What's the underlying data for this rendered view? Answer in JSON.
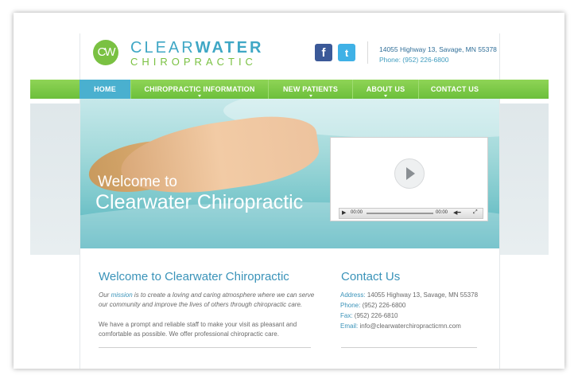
{
  "logo": {
    "mark": "CW",
    "line1_light": "CLEAR",
    "line1_bold": "WATER",
    "line2": "CHIROPRACTIC"
  },
  "social": {
    "facebook": "f",
    "twitter": "t"
  },
  "header_contact": {
    "address": "14055 Highway 13, Savage, MN 55378",
    "phone": "Phone: (952) 226-6800"
  },
  "nav": {
    "items": [
      {
        "label": "HOME",
        "active": true
      },
      {
        "label": "CHIROPRACTIC INFORMATION",
        "dropdown": true
      },
      {
        "label": "NEW PATIENTS",
        "dropdown": true
      },
      {
        "label": "ABOUT US",
        "dropdown": true
      },
      {
        "label": "CONTACT US"
      }
    ]
  },
  "hero": {
    "welcome_line1": "Welcome to",
    "welcome_line2": "Clearwater Chiropractic"
  },
  "video": {
    "time_current": "00:00",
    "time_total": "00:00"
  },
  "welcome": {
    "title": "Welcome to Clearwater Chiropractic",
    "p1_start": "Our ",
    "p1_link": "mission",
    "p1_rest": " is to create a loving and caring atmosphere where we can serve",
    "p1_line2": "our community and improve the lives of others through chiropractic care.",
    "p2_line1": "We have a prompt and reliable staff to make your visit as pleasant and",
    "p2_line2": "comfortable as possible. We offer professional chiropractic care."
  },
  "contact": {
    "title": "Contact Us",
    "address_label": "Address:",
    "address": "14055 Highway 13, Savage, MN 55378",
    "phone_label": "Phone:",
    "phone": "(952) 226-6800",
    "fax_label": "Fax:",
    "fax": "(952) 226-6810",
    "email_label": "Email:",
    "email": "info@clearwaterchiropracticmn.com"
  },
  "colors": {
    "accent_blue": "#3a93b9",
    "accent_green": "#7ac142",
    "nav_active": "#4ab0cf"
  }
}
